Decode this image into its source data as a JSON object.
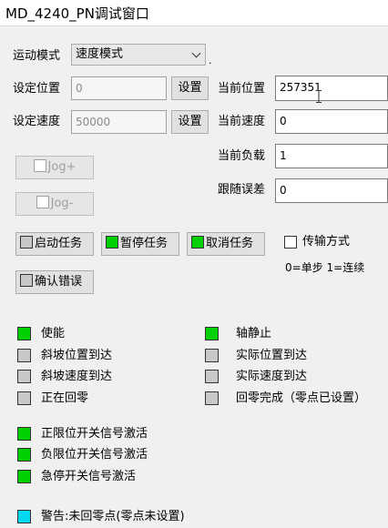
{
  "window": {
    "title": "MD_4240_PN调试窗口"
  },
  "motion_mode": {
    "label": "运动模式",
    "value": "速度模式"
  },
  "set_position": {
    "label": "设定位置",
    "value": "0",
    "button": "设置"
  },
  "set_speed": {
    "label": "设定速度",
    "value": "50000",
    "button": "设置"
  },
  "current_position": {
    "label": "当前位置",
    "value": "257351"
  },
  "current_speed": {
    "label": "当前速度",
    "value": "0"
  },
  "current_load": {
    "label": "当前负载",
    "value": "1"
  },
  "following_error": {
    "label": "跟随误差",
    "value": "0"
  },
  "jog_plus": {
    "label": "Jog+"
  },
  "jog_minus": {
    "label": "Jog-"
  },
  "tasks": {
    "start": "启动任务",
    "pause": "暂停任务",
    "cancel": "取消任务",
    "confirm_error": "确认错误"
  },
  "transfer": {
    "label": "传输方式",
    "hint": "0=单步 1=连续"
  },
  "status": {
    "enable": "使能",
    "axis_still": "轴静止",
    "ramp_position_reached": "斜坡位置到达",
    "actual_position_reached": "实际位置到达",
    "ramp_speed_reached": "斜坡速度到达",
    "actual_speed_reached": "实际速度到达",
    "homing": "正在回零",
    "homing_done": "回零完成（零点已设置）",
    "pos_limit": "正限位开关信号激活",
    "neg_limit": "负限位开关信号激活",
    "estop": "急停开关信号激活",
    "warning": "警告:未回零点(零点未设置)"
  },
  "colors": {
    "green": "#00d000",
    "gray": "#c8c8c8",
    "cyan": "#00d8f0"
  }
}
